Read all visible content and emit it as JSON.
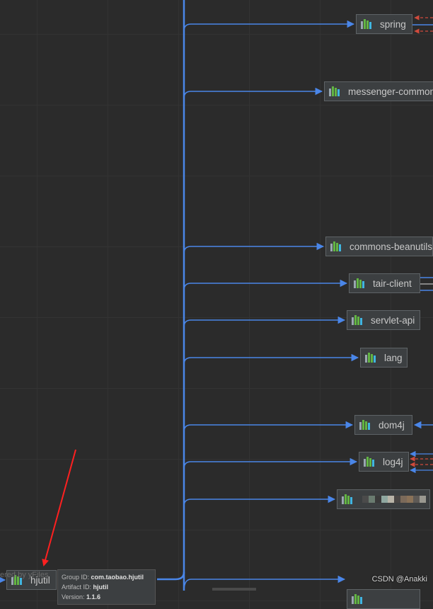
{
  "nodes": [
    {
      "id": "spring",
      "label": "spring"
    },
    {
      "id": "messenger-common",
      "label": "messenger-common"
    },
    {
      "id": "commons-beanutils",
      "label": "commons-beanutils"
    },
    {
      "id": "tair-client",
      "label": "tair-client"
    },
    {
      "id": "servlet-api",
      "label": "servlet-api"
    },
    {
      "id": "lang",
      "label": "lang"
    },
    {
      "id": "dom4j",
      "label": "dom4j"
    },
    {
      "id": "log4j",
      "label": "log4j"
    },
    {
      "id": "obscured-node",
      "label": ""
    },
    {
      "id": "hjutil",
      "label": "hjutil"
    },
    {
      "id": "bottom-node",
      "label": ""
    }
  ],
  "tooltip": {
    "group_label": "Group ID:",
    "group_value": "com.taobao.hjutil",
    "artifact_label": "Artifact ID:",
    "artifact_value": "hjutil",
    "version_label": "Version:",
    "version_value": "1.1.6"
  },
  "footer": {
    "yfiles_text": "ered by yFiles",
    "watermark": "CSDN @Anakki"
  },
  "colors": {
    "edge_blue": "#4a86e8",
    "edge_red_dashed": "#d04a3c",
    "annotation_arrow": "#ff2020",
    "node_bg": "#3c3f41",
    "node_border": "#5e6366"
  }
}
